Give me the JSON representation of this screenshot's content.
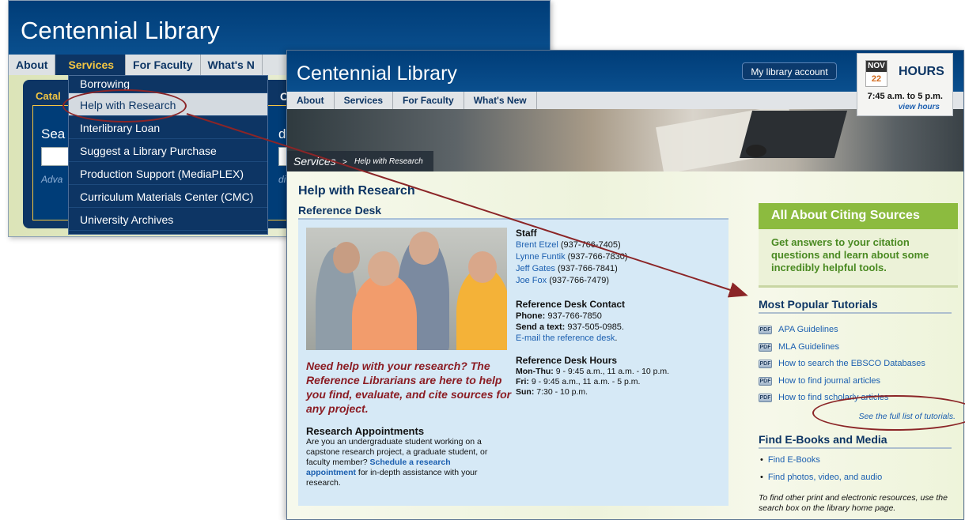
{
  "back_window": {
    "logo": "Centennial Library",
    "nav": [
      "About",
      "Services",
      "For Faculty",
      "What's N"
    ],
    "tab_catalog": "Catal",
    "tab_c": "C",
    "search_label": "Sea",
    "search_label_right": "d m",
    "advanced": "Adva",
    "additional": "ditio",
    "dropdown": [
      "Borrowing",
      "Help with Research",
      "Interlibrary Loan",
      "Suggest a Library Purchase",
      "Production Support (MediaPLEX)",
      "Curriculum Materials Center (CMC)",
      "University Archives"
    ]
  },
  "front_window": {
    "logo": "Centennial Library",
    "account_button": "My library account",
    "hours": {
      "month": "NOV",
      "day": "22",
      "title": "HOURS",
      "time": "7:45 a.m. to 5 p.m.",
      "view": "view hours"
    },
    "nav": [
      "About",
      "Services",
      "For Faculty",
      "What's New"
    ],
    "breadcrumb": {
      "section": "Services",
      "separator": ">",
      "page": "Help with Research"
    },
    "page_title": "Help with Research",
    "section_title": "Reference Desk",
    "staff": {
      "title": "Staff",
      "members": [
        {
          "name": "Brent Etzel",
          "phone": "(937-766-7405)"
        },
        {
          "name": "Lynne Funtik",
          "phone": "(937-766-7830)"
        },
        {
          "name": "Jeff Gates",
          "phone": "(937-766-7841)"
        },
        {
          "name": "Joe Fox",
          "phone": "(937-766-7479)"
        }
      ]
    },
    "contact": {
      "title": "Reference Desk Contact",
      "phone_label": "Phone:",
      "phone": "937-766-7850",
      "text_label": "Send a text:",
      "text": "937-505-0985.",
      "email_link": "E-mail the reference desk",
      "email_end": "."
    },
    "desk_hours": {
      "title": "Reference Desk Hours",
      "rows": [
        {
          "day": "Mon-Thu:",
          "time": "9 - 9:45 a.m., 11 a.m. - 10 p.m."
        },
        {
          "day": "Fri:",
          "time": "9 - 9:45 a.m., 11 a.m. - 5 p.m."
        },
        {
          "day": "Sun:",
          "time": "7:30 - 10 p.m."
        }
      ]
    },
    "quote": "Need help with your research? The Reference Librarians are here to help you find, evaluate, and cite sources for any project.",
    "appointments": {
      "title": "Research Appointments",
      "text_before": "Are you an undergraduate student working on a capstone research project, a graduate student, or faculty member? ",
      "link": "Schedule a research appointment",
      "text_after": " for in-depth assistance with your research."
    },
    "citing": {
      "title": "All About Citing Sources",
      "body": "Get answers to your citation questions and learn about some incredibly helpful tools."
    },
    "tutorials": {
      "title": "Most Popular Tutorials",
      "icon_label": "PDF",
      "items": [
        "APA Guidelines",
        "MLA Guidelines",
        "How to search the EBSCO Databases",
        "How to find journal articles",
        "How to find scholarly articles"
      ],
      "full_list": "See the full list of tutorials."
    },
    "ebooks": {
      "title": "Find E-Books and Media",
      "items": [
        "Find E-Books",
        "Find photos, video, and audio"
      ],
      "note": "To find other print and electronic resources, use the search box on the library home page."
    }
  },
  "colors": {
    "brand_navy": "#0d3564",
    "accent_gold": "#f4c642",
    "annotation": "#8b2527",
    "green": "#8cbb3f"
  }
}
